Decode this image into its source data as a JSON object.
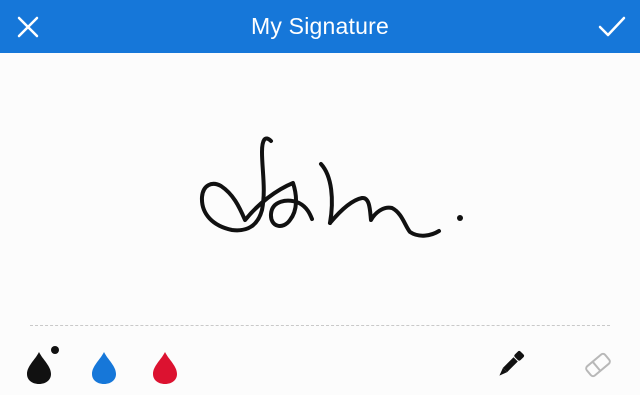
{
  "header": {
    "title": "My Signature",
    "close_icon": "close-icon",
    "done_icon": "checkmark-icon"
  },
  "colors": {
    "header_bg": "#1677d9",
    "ink_black": "#111111",
    "ink_blue": "#1677d9",
    "ink_red": "#dc1230",
    "selected_ink": "black"
  },
  "signature": {
    "ink_color": "#111111",
    "icon": "handwritten-signature"
  },
  "tools": {
    "inks": [
      {
        "name": "black",
        "color": "#111111",
        "selected": true
      },
      {
        "name": "blue",
        "color": "#1677d9",
        "selected": false
      },
      {
        "name": "red",
        "color": "#dc1230",
        "selected": false
      }
    ],
    "pen": {
      "icon": "pen-icon",
      "active": true
    },
    "eraser": {
      "icon": "eraser-icon",
      "active": false
    }
  }
}
